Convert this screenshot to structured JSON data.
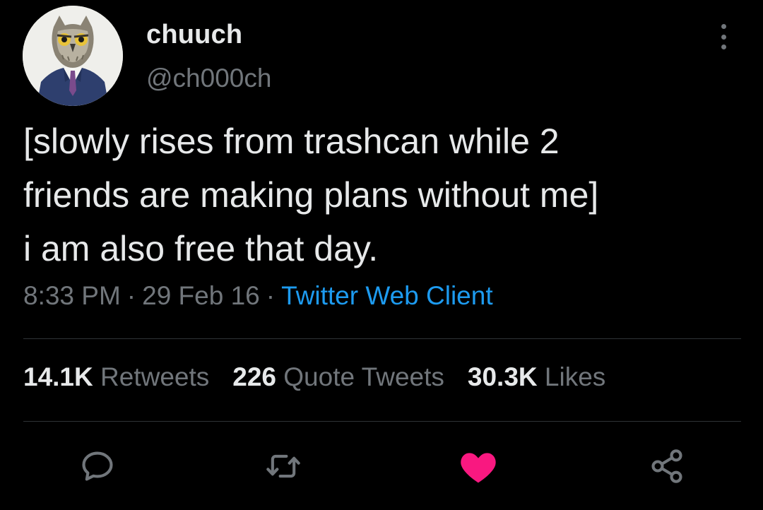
{
  "user": {
    "display_name": "chuuch",
    "handle": "@ch000ch",
    "avatar": "owl-in-suit-avatar"
  },
  "tweet": {
    "lines": [
      "[slowly rises from trashcan while 2",
      "friends are making plans without me]",
      "i am also free that day."
    ],
    "time": "8:33 PM",
    "date": "29 Feb 16",
    "separator": "·",
    "source": "Twitter Web Client"
  },
  "stats": {
    "retweets_count": "14.1K",
    "retweets_label": "Retweets",
    "quotes_count": "226",
    "quotes_label": "Quote Tweets",
    "likes_count": "30.3K",
    "likes_label": "Likes"
  },
  "actions": {
    "reply_icon": "reply-icon",
    "retweet_icon": "retweet-icon",
    "like_icon": "heart-icon",
    "share_icon": "share-icon",
    "like_color": "#f91880"
  },
  "colors": {
    "background": "#000000",
    "text": "#e7e9ea",
    "secondary": "#71767b",
    "link": "#1d9bf0",
    "divider": "#2f3336"
  }
}
